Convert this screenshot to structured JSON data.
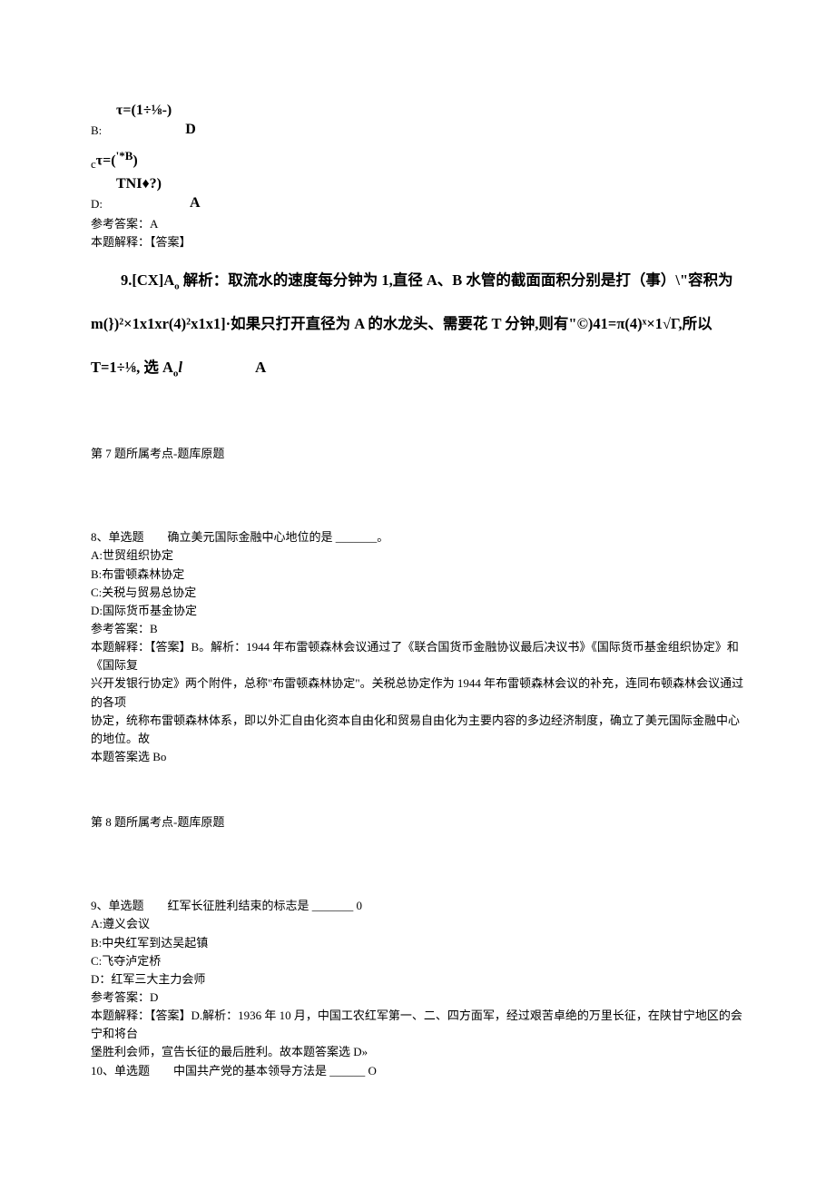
{
  "top": {
    "tau1": "τ=(1÷⅛-)",
    "bLabel": "B:",
    "bTail": "D",
    "cLine_prefix": "c",
    "cLine_mid": "τ=(",
    "cLine_mid2": "'*B",
    "cLine_tail": ")",
    "tni": "TNI♦?)",
    "dLabel": "D:",
    "dTail": "A",
    "refAns": "参考答案：A",
    "explain": "本题解释：【答案】",
    "e9_l1_a": "9.[CX]A",
    "e9_l1_b": " 解析：取流水的速度每分钟为 1,直径 A、B 水管的截面面积分别是打（事）\\\"容积为",
    "e9_l2": "m(})²×1x1xr(4)²x1x1]·如果只打开直径为 A 的水龙头、需要花 T 分钟,则有\"©)41=π(4)ˣ×1√Γ,所以",
    "e9_l3_a": "T=1÷⅛, 选 A",
    "e9_l3_b": "l",
    "e9_l3_tail": "A"
  },
  "q7note": "第 7 题所属考点-题库原题",
  "q8": {
    "header": "8、单选题　　确立美元国际金融中心地位的是 _______。",
    "A": "A:世贸组织协定",
    "B": "B:布雷顿森林协定",
    "C": "C:关税与贸易总协定",
    "D": "D:国际货币基金协定",
    "ref": "参考答案：B",
    "exp1": "本题解释：【答案】B。解析：1944 年布雷顿森林会议通过了《联合国货币金融协议最后决议书》《国际货币基金组织协定》和《国际复",
    "exp2": "兴开发银行协定》两个附件，总称\"布雷顿森林协定\"。关税总协定作为 1944 年布雷顿森林会议的补充，连同布顿森林会议通过的各项",
    "exp3": "协定，统称布雷顿森林体系，即以外汇自由化资本自由化和贸易自由化为主要内容的多边经济制度，确立了美元国际金融中心的地位。故",
    "exp4": "本题答案选 Bo"
  },
  "q8note": "第 8 题所属考点-题库原题",
  "q9": {
    "header": "9、单选题　　红军长征胜利结束的标志是 _______ 0",
    "A": "A:遵义会议",
    "B": "B:中央红军到达吴起镇",
    "C": "C:飞夺泸定桥",
    "D": "D：红军三大主力会师",
    "ref": "参考答案：D",
    "exp1": "本题解释：【答案】D.解析：1936 年 10 月，中国工农红军第一、二、四方面军，经过艰苦卓绝的万里长征，在陕甘宁地区的会宁和将台",
    "exp2": "堡胜利会师，宣告长征的最后胜利。故本题答案选 D»"
  },
  "q10": {
    "header": "10、单选题　　中国共产党的基本领导方法是 ______ O"
  }
}
